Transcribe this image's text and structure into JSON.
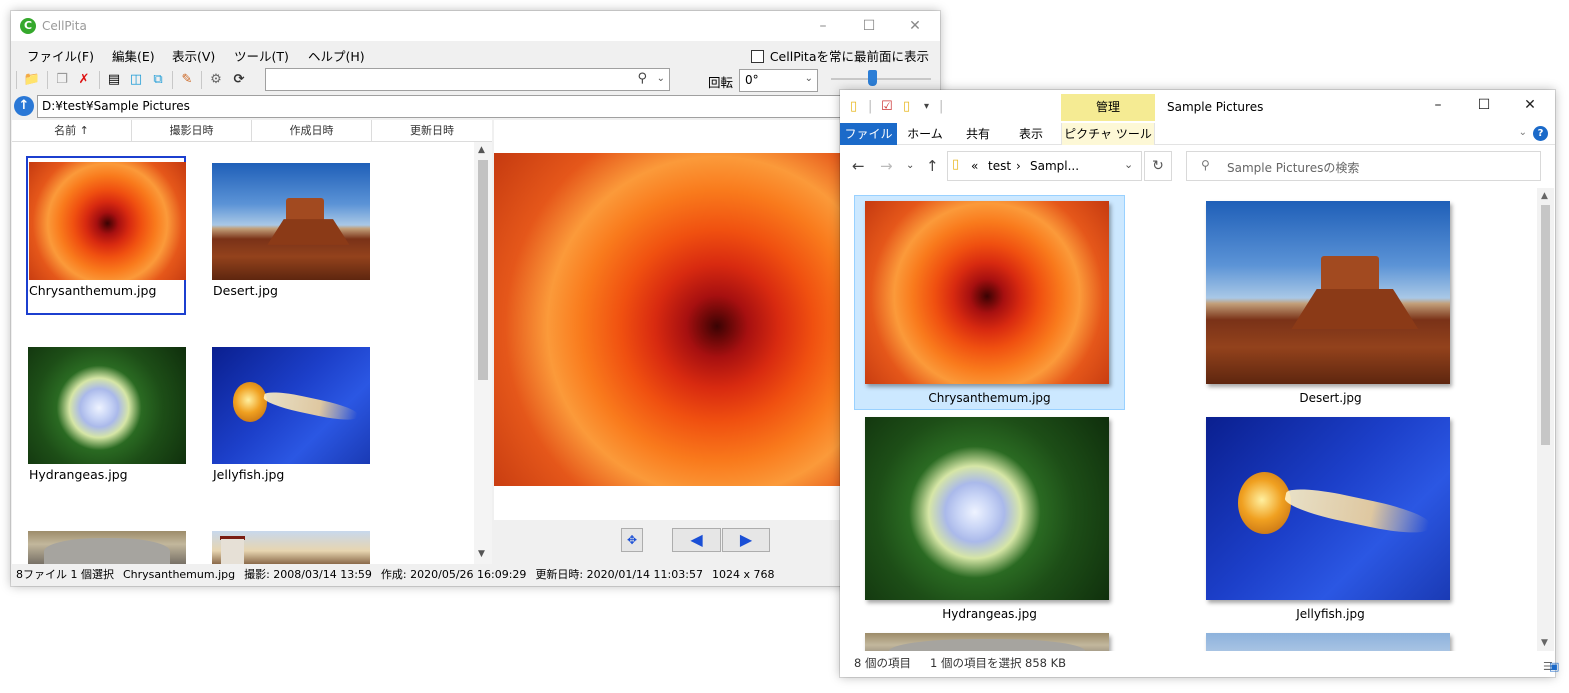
{
  "cellpita": {
    "title": "CellPita",
    "menu": [
      "ファイル(F)",
      "編集(E)",
      "表示(V)",
      "ツール(T)",
      "ヘルプ(H)"
    ],
    "always_on_top_label": "CellPitaを常に最前面に表示",
    "rotation_label": "回転",
    "rotation_value": "0°",
    "path": "D:¥test¥Sample Pictures",
    "columns": [
      "名前 ↑",
      "撮影日時",
      "作成日時",
      "更新日時"
    ],
    "files": [
      {
        "name": "Chrysanthemum.jpg",
        "selected": true
      },
      {
        "name": "Desert.jpg"
      },
      {
        "name": "Hydrangeas.jpg"
      },
      {
        "name": "Jellyfish.jpg"
      },
      {
        "name": ""
      },
      {
        "name": ""
      }
    ],
    "status": {
      "count": "8ファイル 1 個選択",
      "file": "Chrysanthemum.jpg",
      "shot": "撮影: 2008/03/14 13:59",
      "created": "作成: 2020/05/26 16:09:29",
      "modified": "更新日時: 2020/01/14 11:03:57",
      "size": "1024 x 768"
    }
  },
  "explorer": {
    "title": "Sample Pictures",
    "context_tab": "管理",
    "tabs": [
      "ファイル",
      "ホーム",
      "共有",
      "表示",
      "ピクチャ ツール"
    ],
    "breadcrumb": [
      "«",
      "test",
      "›",
      "Sampl..."
    ],
    "search_placeholder": "Sample Picturesの検索",
    "files": [
      {
        "name": "Chrysanthemum.jpg",
        "selected": true
      },
      {
        "name": "Desert.jpg"
      },
      {
        "name": "Hydrangeas.jpg"
      },
      {
        "name": "Jellyfish.jpg"
      }
    ],
    "status": {
      "count": "8 個の項目",
      "selection": "1 個の項目を選択",
      "size": "858 KB"
    }
  }
}
